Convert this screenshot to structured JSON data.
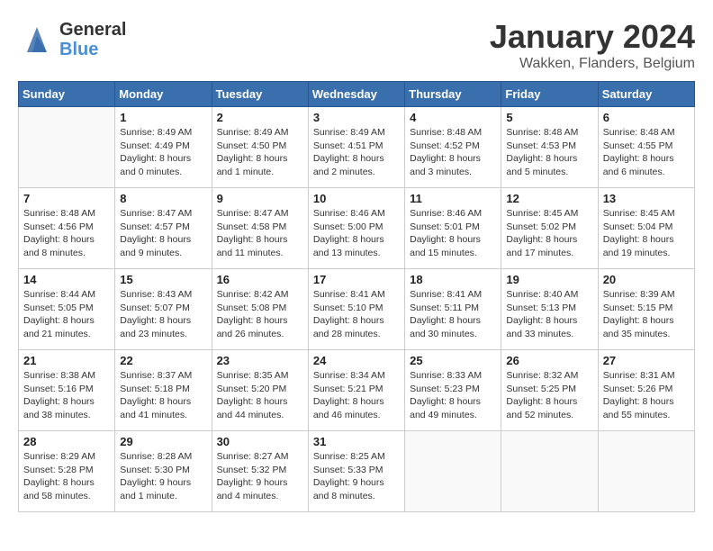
{
  "logo": {
    "general": "General",
    "blue": "Blue",
    "arrow": "▶"
  },
  "title": "January 2024",
  "location": "Wakken, Flanders, Belgium",
  "days_of_week": [
    "Sunday",
    "Monday",
    "Tuesday",
    "Wednesday",
    "Thursday",
    "Friday",
    "Saturday"
  ],
  "weeks": [
    [
      {
        "day": null,
        "info": null
      },
      {
        "day": "1",
        "sunrise": "8:49 AM",
        "sunset": "4:49 PM",
        "daylight": "8 hours and 0 minutes."
      },
      {
        "day": "2",
        "sunrise": "8:49 AM",
        "sunset": "4:50 PM",
        "daylight": "8 hours and 1 minute."
      },
      {
        "day": "3",
        "sunrise": "8:49 AM",
        "sunset": "4:51 PM",
        "daylight": "8 hours and 2 minutes."
      },
      {
        "day": "4",
        "sunrise": "8:48 AM",
        "sunset": "4:52 PM",
        "daylight": "8 hours and 3 minutes."
      },
      {
        "day": "5",
        "sunrise": "8:48 AM",
        "sunset": "4:53 PM",
        "daylight": "8 hours and 5 minutes."
      },
      {
        "day": "6",
        "sunrise": "8:48 AM",
        "sunset": "4:55 PM",
        "daylight": "8 hours and 6 minutes."
      }
    ],
    [
      {
        "day": "7",
        "sunrise": "8:48 AM",
        "sunset": "4:56 PM",
        "daylight": "8 hours and 8 minutes."
      },
      {
        "day": "8",
        "sunrise": "8:47 AM",
        "sunset": "4:57 PM",
        "daylight": "8 hours and 9 minutes."
      },
      {
        "day": "9",
        "sunrise": "8:47 AM",
        "sunset": "4:58 PM",
        "daylight": "8 hours and 11 minutes."
      },
      {
        "day": "10",
        "sunrise": "8:46 AM",
        "sunset": "5:00 PM",
        "daylight": "8 hours and 13 minutes."
      },
      {
        "day": "11",
        "sunrise": "8:46 AM",
        "sunset": "5:01 PM",
        "daylight": "8 hours and 15 minutes."
      },
      {
        "day": "12",
        "sunrise": "8:45 AM",
        "sunset": "5:02 PM",
        "daylight": "8 hours and 17 minutes."
      },
      {
        "day": "13",
        "sunrise": "8:45 AM",
        "sunset": "5:04 PM",
        "daylight": "8 hours and 19 minutes."
      }
    ],
    [
      {
        "day": "14",
        "sunrise": "8:44 AM",
        "sunset": "5:05 PM",
        "daylight": "8 hours and 21 minutes."
      },
      {
        "day": "15",
        "sunrise": "8:43 AM",
        "sunset": "5:07 PM",
        "daylight": "8 hours and 23 minutes."
      },
      {
        "day": "16",
        "sunrise": "8:42 AM",
        "sunset": "5:08 PM",
        "daylight": "8 hours and 26 minutes."
      },
      {
        "day": "17",
        "sunrise": "8:41 AM",
        "sunset": "5:10 PM",
        "daylight": "8 hours and 28 minutes."
      },
      {
        "day": "18",
        "sunrise": "8:41 AM",
        "sunset": "5:11 PM",
        "daylight": "8 hours and 30 minutes."
      },
      {
        "day": "19",
        "sunrise": "8:40 AM",
        "sunset": "5:13 PM",
        "daylight": "8 hours and 33 minutes."
      },
      {
        "day": "20",
        "sunrise": "8:39 AM",
        "sunset": "5:15 PM",
        "daylight": "8 hours and 35 minutes."
      }
    ],
    [
      {
        "day": "21",
        "sunrise": "8:38 AM",
        "sunset": "5:16 PM",
        "daylight": "8 hours and 38 minutes."
      },
      {
        "day": "22",
        "sunrise": "8:37 AM",
        "sunset": "5:18 PM",
        "daylight": "8 hours and 41 minutes."
      },
      {
        "day": "23",
        "sunrise": "8:35 AM",
        "sunset": "5:20 PM",
        "daylight": "8 hours and 44 minutes."
      },
      {
        "day": "24",
        "sunrise": "8:34 AM",
        "sunset": "5:21 PM",
        "daylight": "8 hours and 46 minutes."
      },
      {
        "day": "25",
        "sunrise": "8:33 AM",
        "sunset": "5:23 PM",
        "daylight": "8 hours and 49 minutes."
      },
      {
        "day": "26",
        "sunrise": "8:32 AM",
        "sunset": "5:25 PM",
        "daylight": "8 hours and 52 minutes."
      },
      {
        "day": "27",
        "sunrise": "8:31 AM",
        "sunset": "5:26 PM",
        "daylight": "8 hours and 55 minutes."
      }
    ],
    [
      {
        "day": "28",
        "sunrise": "8:29 AM",
        "sunset": "5:28 PM",
        "daylight": "8 hours and 58 minutes."
      },
      {
        "day": "29",
        "sunrise": "8:28 AM",
        "sunset": "5:30 PM",
        "daylight": "9 hours and 1 minute."
      },
      {
        "day": "30",
        "sunrise": "8:27 AM",
        "sunset": "5:32 PM",
        "daylight": "9 hours and 4 minutes."
      },
      {
        "day": "31",
        "sunrise": "8:25 AM",
        "sunset": "5:33 PM",
        "daylight": "9 hours and 8 minutes."
      },
      {
        "day": null,
        "info": null
      },
      {
        "day": null,
        "info": null
      },
      {
        "day": null,
        "info": null
      }
    ]
  ],
  "labels": {
    "sunrise": "Sunrise:",
    "sunset": "Sunset:",
    "daylight": "Daylight:"
  }
}
